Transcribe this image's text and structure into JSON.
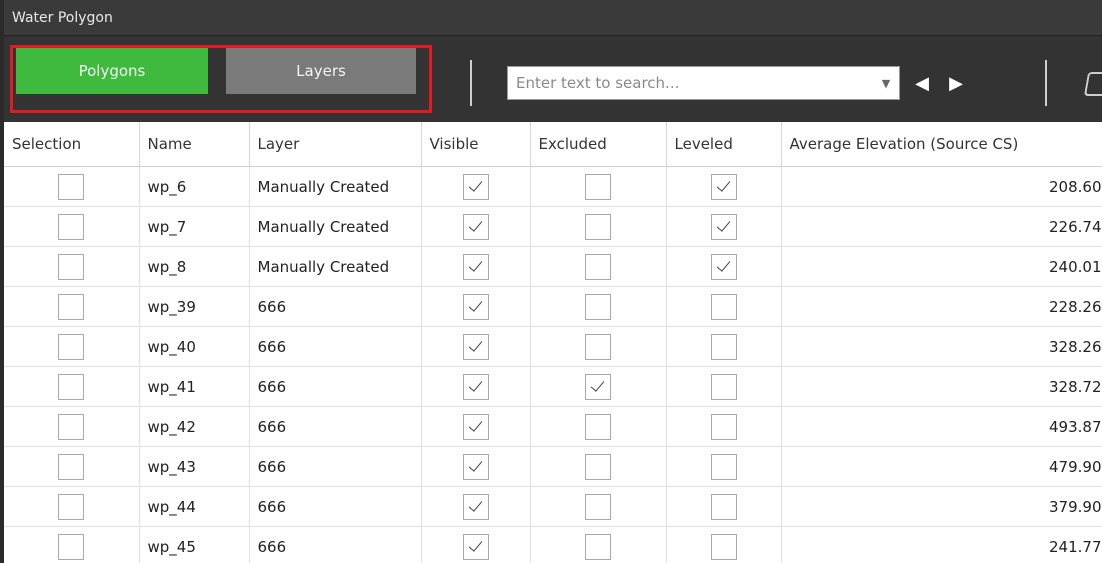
{
  "window": {
    "title": "Water Polygon"
  },
  "toolbar": {
    "tabs": [
      {
        "label": "Polygons",
        "active": true
      },
      {
        "label": "Layers",
        "active": false
      }
    ],
    "search": {
      "placeholder": "Enter text to search...",
      "value": ""
    },
    "icons": {
      "dropdown": "chevron-down-icon",
      "prev": "arrow-left-icon",
      "next": "arrow-right-icon"
    }
  },
  "table": {
    "columns": [
      "Selection",
      "Name",
      "Layer",
      "Visible",
      "Excluded",
      "Leveled",
      "Average Elevation (Source CS)"
    ],
    "rows": [
      {
        "selection": false,
        "name": "wp_6",
        "layer": "Manually Created",
        "visible": true,
        "excluded": false,
        "leveled": true,
        "elevation": "208.60"
      },
      {
        "selection": false,
        "name": "wp_7",
        "layer": "Manually Created",
        "visible": true,
        "excluded": false,
        "leveled": true,
        "elevation": "226.74"
      },
      {
        "selection": false,
        "name": "wp_8",
        "layer": "Manually Created",
        "visible": true,
        "excluded": false,
        "leveled": true,
        "elevation": "240.01"
      },
      {
        "selection": false,
        "name": "wp_39",
        "layer": "666",
        "visible": true,
        "excluded": false,
        "leveled": false,
        "elevation": "228.26"
      },
      {
        "selection": false,
        "name": "wp_40",
        "layer": "666",
        "visible": true,
        "excluded": false,
        "leveled": false,
        "elevation": "328.26"
      },
      {
        "selection": false,
        "name": "wp_41",
        "layer": "666",
        "visible": true,
        "excluded": true,
        "leveled": false,
        "elevation": "328.72"
      },
      {
        "selection": false,
        "name": "wp_42",
        "layer": "666",
        "visible": true,
        "excluded": false,
        "leveled": false,
        "elevation": "493.87"
      },
      {
        "selection": false,
        "name": "wp_43",
        "layer": "666",
        "visible": true,
        "excluded": false,
        "leveled": false,
        "elevation": "479.90"
      },
      {
        "selection": false,
        "name": "wp_44",
        "layer": "666",
        "visible": true,
        "excluded": false,
        "leveled": false,
        "elevation": "379.90"
      },
      {
        "selection": false,
        "name": "wp_45",
        "layer": "666",
        "visible": true,
        "excluded": false,
        "leveled": false,
        "elevation": "241.77"
      }
    ]
  },
  "colors": {
    "active_tab": "#3fba3f",
    "inactive_tab": "#7a7a7a",
    "highlight_border": "#e11b22",
    "toolbar_bg": "#333333"
  }
}
